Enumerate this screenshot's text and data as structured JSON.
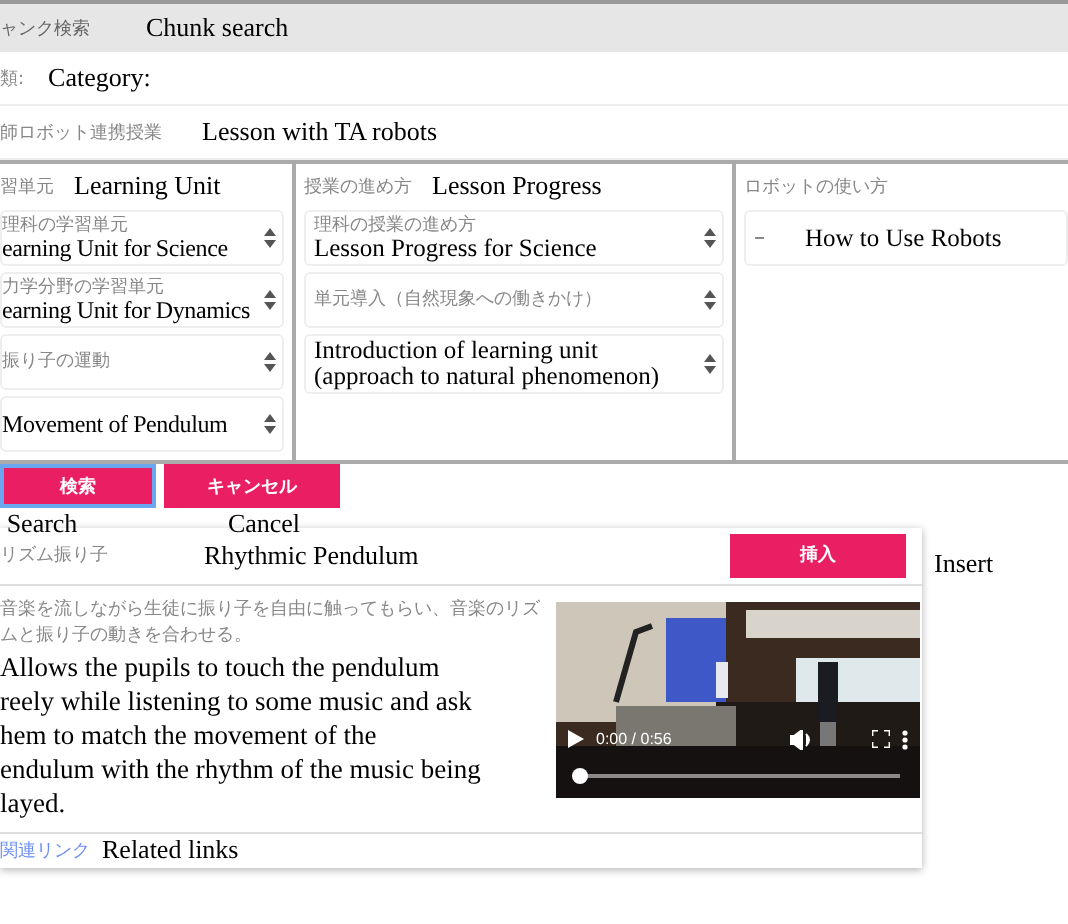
{
  "header": {
    "title": "ャンク検索",
    "translation": "Chunk search"
  },
  "category": {
    "label": "類:",
    "translation": "Category:"
  },
  "lesson_type": {
    "value": "師ロボット連携授業",
    "translation": "Lesson with TA robots"
  },
  "columns": [
    {
      "label": "習単元",
      "translation": "Learning Unit",
      "selects": [
        {
          "kind": "stacked",
          "text": "理科の学習単元",
          "translation": "earning Unit for Science"
        },
        {
          "kind": "stacked",
          "text": "力学分野の学習単元",
          "translation": "earning Unit for Dynamics"
        },
        {
          "kind": "stacked",
          "text": "振り子の運動"
        },
        {
          "kind": "stacked",
          "translation": "Movement of Pendulum"
        }
      ]
    },
    {
      "label": "授業の進め方",
      "translation": "Lesson Progress",
      "selects": [
        {
          "kind": "stacked",
          "text": "理科の授業の進め方",
          "translation": "Lesson Progress for Science"
        },
        {
          "kind": "stacked",
          "text": "単元導入（自然現象への働きかけ）"
        },
        {
          "kind": "stacked",
          "translation": "Introduction of learning unit (approach to natural phenomenon)"
        }
      ]
    },
    {
      "label": "ロボットの使い方",
      "selects": [
        {
          "kind": "inline",
          "text": "–",
          "translation": "How to Use Robots"
        }
      ]
    }
  ],
  "buttons": [
    {
      "label": "検索",
      "translation": "Search",
      "focused": true
    },
    {
      "label": "キャンセル",
      "translation": "Cancel",
      "focused": false
    }
  ],
  "result": {
    "title": "リズム振り子",
    "translation": "Rhythmic Pendulum",
    "insert_button": "挿入",
    "insert_translation": "Insert",
    "description_lines": [
      "音楽を流しながら生徒に振り子を自由に触ってもらい、音楽のリズ",
      "ムと振り子の動きを合わせる。"
    ],
    "translation_lines": [
      "Allows the pupils to touch the pendulum",
      "reely while listening to some music and ask",
      "hem to match the movement of the",
      "endulum with the rhythm of the music being",
      "layed."
    ],
    "video": {
      "kind": "picture",
      "time": "0:00 / 0:56",
      "level": 0
    },
    "links_label": "関連リンク",
    "links_translation": "Related links"
  }
}
